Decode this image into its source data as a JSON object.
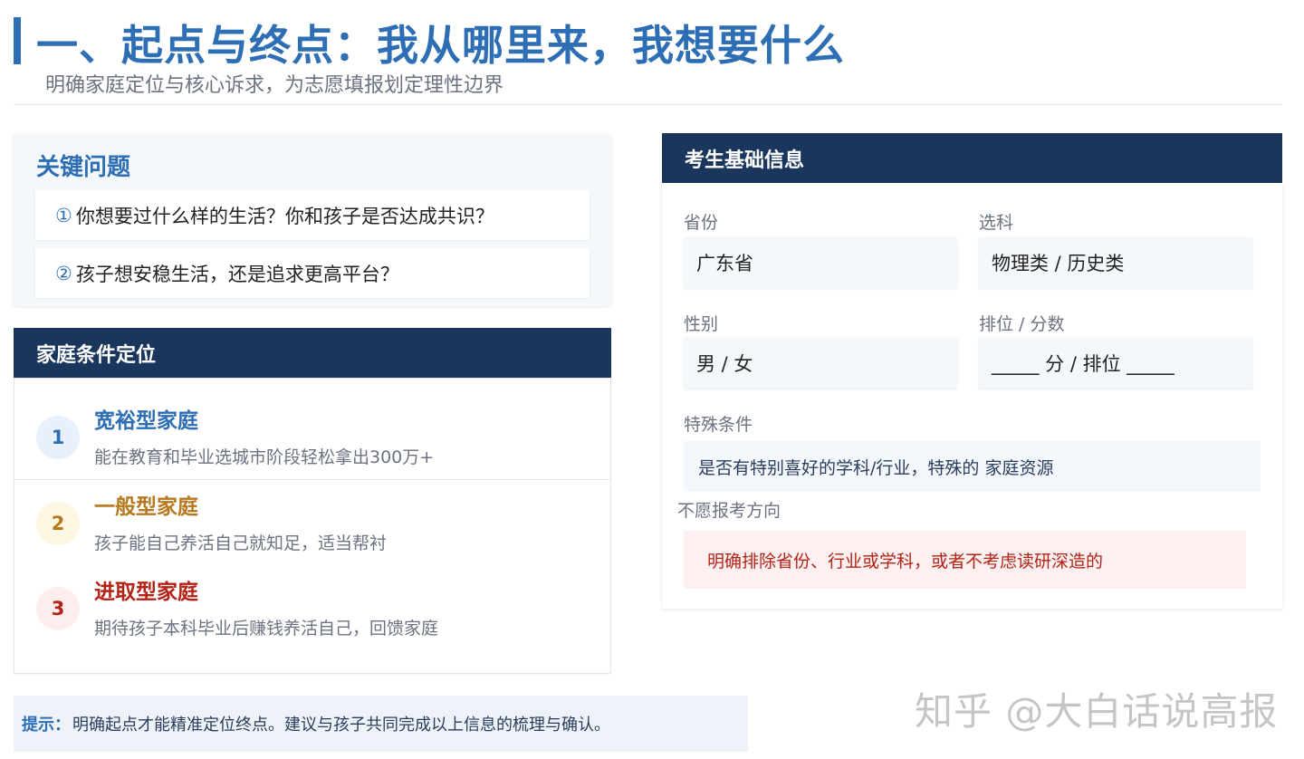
{
  "header": {
    "title": "一、起点与终点：我从哪里来，我想要什么",
    "subtitle": "明确家庭定位与核心诉求，为志愿填报划定理性边界"
  },
  "key_questions": {
    "title": "关键问题",
    "items": [
      {
        "num": "①",
        "text": "你想要过什么样的生活？你和孩子是否达成共识？"
      },
      {
        "num": "②",
        "text": "孩子想安稳生活，还是追求更高平台？"
      }
    ]
  },
  "family": {
    "title": "家庭条件定位",
    "items": [
      {
        "num": "1",
        "title": "宽裕型家庭",
        "desc": "能在教育和毕业选城市阶段轻松拿出300万+",
        "color": "#2e6eb5",
        "bg": "#e8f1fb"
      },
      {
        "num": "2",
        "title": "一般型家庭",
        "desc": "孩子能自己养活自己就知足，适当帮衬",
        "color": "#b7791f",
        "bg": "#fdf6e3"
      },
      {
        "num": "3",
        "title": "进取型家庭",
        "desc": "期待孩子本科毕业后赚钱养活自己，回馈家庭",
        "color": "#b42318",
        "bg": "#fdeeee"
      }
    ]
  },
  "info": {
    "title": "考生基础信息",
    "province_label": "省份",
    "province_value": "广东省",
    "subject_label": "选科",
    "subject_value": "物理类 / 历史类",
    "gender_label": "性别",
    "gender_value": "男 / 女",
    "rank_label": "排位 / 分数",
    "rank_value": "_____ 分 / 排位 _____",
    "special_label": "特殊条件",
    "special_value": "是否有特别喜好的学科/行业，特殊的 家庭资源",
    "exclude_label": "不愿报考方向",
    "exclude_value": "明确排除省份、行业或学科，或者不考虑读研深造的"
  },
  "tip": {
    "label": "提示：",
    "text": "明确起点才能精准定位终点。建议与孩子共同完成以上信息的梳理与确认。"
  },
  "watermark": "知乎 @大白话说高报"
}
